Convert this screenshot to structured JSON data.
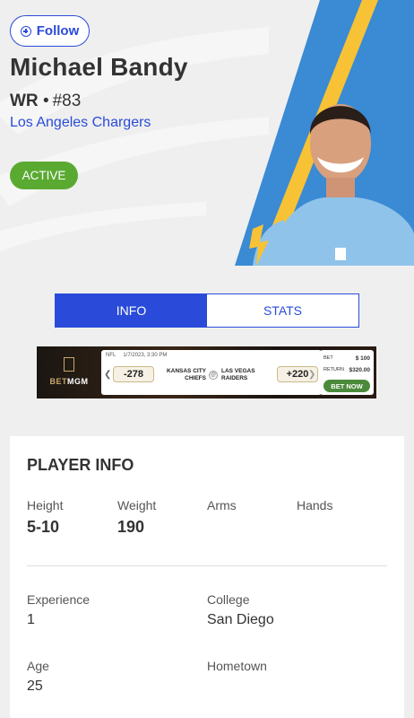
{
  "header": {
    "follow_label": "Follow",
    "player_name": "Michael Bandy",
    "position": "WR",
    "separator": "•",
    "number": "#83",
    "team": "Los Angeles Chargers",
    "status": "ACTIVE"
  },
  "tabs": [
    {
      "label": "INFO",
      "active": true
    },
    {
      "label": "STATS",
      "active": false
    }
  ],
  "ad": {
    "brand_prefix": "BET",
    "brand_suffix": "MGM",
    "league": "NFL",
    "date": "1/7/2023, 3:30 PM",
    "away_odds": "-278",
    "away_team_line1": "KANSAS CITY",
    "away_team_line2": "CHIEFS",
    "home_team_line1": "LAS VEGAS",
    "home_team_line2": "RAIDERS",
    "home_odds": "+220",
    "bet_label": "BET",
    "bet_amount": "$ 100",
    "return_label": "RETURN",
    "return_amount": "$320.00",
    "cta": "BET NOW"
  },
  "player_info": {
    "title": "PLAYER INFO",
    "height_label": "Height",
    "height_value": "5-10",
    "weight_label": "Weight",
    "weight_value": "190",
    "arms_label": "Arms",
    "hands_label": "Hands",
    "experience_label": "Experience",
    "experience_value": "1",
    "college_label": "College",
    "college_value": "San Diego",
    "age_label": "Age",
    "age_value": "25",
    "hometown_label": "Hometown"
  },
  "colors": {
    "accent_blue": "#2a4bd9",
    "active_green": "#5aaa32",
    "chargers_powder": "#3a8ad4",
    "chargers_gold": "#f7c235"
  }
}
